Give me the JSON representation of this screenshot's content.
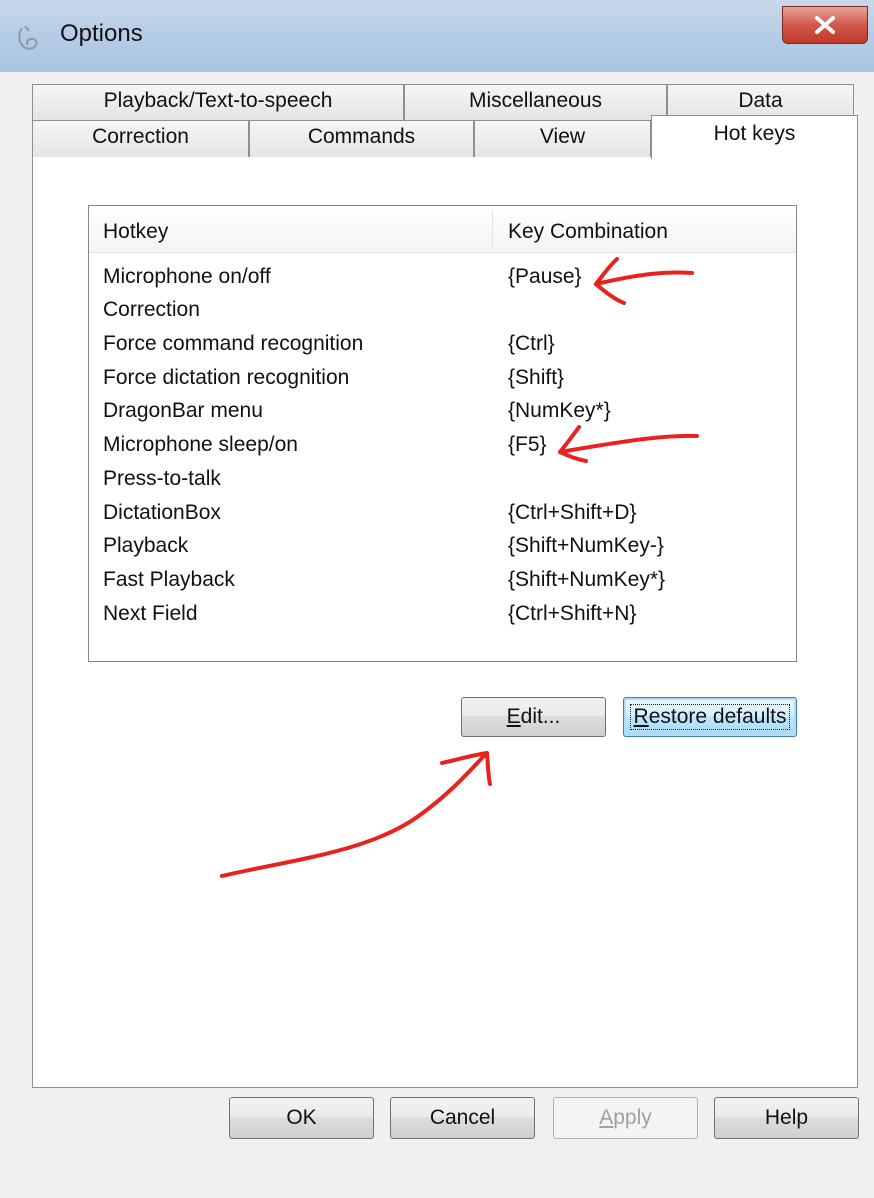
{
  "window": {
    "title": "Options",
    "app_icon": "dragon-logo-icon",
    "close_icon": "close-icon"
  },
  "tabs": {
    "row_back": [
      {
        "label": "Playback/Text-to-speech"
      },
      {
        "label": "Miscellaneous"
      },
      {
        "label": "Data"
      }
    ],
    "row_front": [
      {
        "label": "Correction"
      },
      {
        "label": "Commands"
      },
      {
        "label": "View"
      },
      {
        "label": "Hot keys",
        "active": true
      }
    ]
  },
  "hotkeys": {
    "columns": {
      "hotkey": "Hotkey",
      "combination": "Key Combination"
    },
    "rows": [
      {
        "name": "Microphone on/off",
        "keys": "{Pause}"
      },
      {
        "name": "Correction",
        "keys": ""
      },
      {
        "name": "Force command recognition",
        "keys": "{Ctrl}"
      },
      {
        "name": "Force dictation recognition",
        "keys": "{Shift}"
      },
      {
        "name": "DragonBar menu",
        "keys": "{NumKey*}"
      },
      {
        "name": "Microphone sleep/on",
        "keys": "{F5}"
      },
      {
        "name": "Press-to-talk",
        "keys": ""
      },
      {
        "name": "DictationBox",
        "keys": "{Ctrl+Shift+D}"
      },
      {
        "name": "Playback",
        "keys": "{Shift+NumKey-}"
      },
      {
        "name": "Fast Playback",
        "keys": "{Shift+NumKey*}"
      },
      {
        "name": "Next Field",
        "keys": "{Ctrl+Shift+N}"
      }
    ]
  },
  "panel_buttons": {
    "edit": {
      "mnemonic": "E",
      "rest": "dit..."
    },
    "restore": {
      "mnemonic": "R",
      "rest": "estore defaults"
    }
  },
  "dialog_buttons": {
    "ok": "OK",
    "cancel": "Cancel",
    "apply": {
      "mnemonic": "A",
      "rest": "pply",
      "enabled": false
    },
    "help": "Help"
  },
  "colors": {
    "annotation_red": "#e8231f",
    "title_bar": "#b7cde6",
    "close_button": "#c9483a",
    "focus_border": "#3c7fb1"
  }
}
